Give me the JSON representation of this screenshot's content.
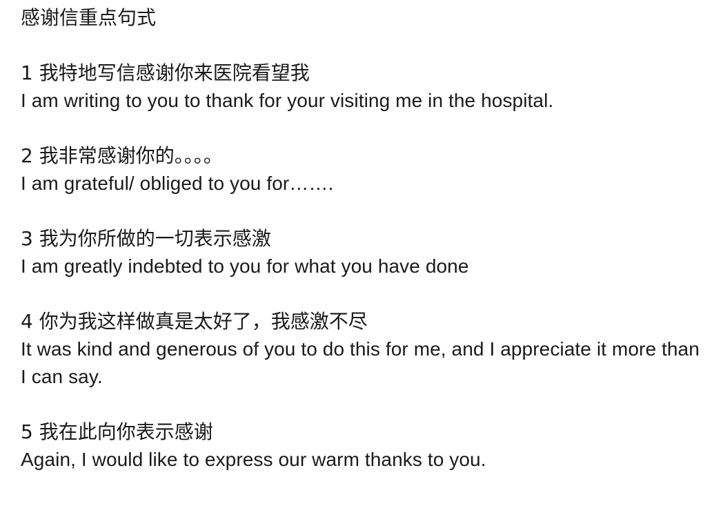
{
  "title": "感谢信重点句式",
  "items": [
    {
      "cn": "1 我特地写信感谢你来医院看望我",
      "en": "I am writing to you to thank for your visiting me in the hospital."
    },
    {
      "cn": "2 我非常感谢你的。。。。",
      "en": "I am grateful/ obliged to you for……."
    },
    {
      "cn": "3 我为你所做的一切表示感激",
      "en": "I am greatly indebted to you for what you have done"
    },
    {
      "cn": "4 你为我这样做真是太好了，我感激不尽",
      "en": "It was kind and generous of you to do this for me, and I appreciate it more than I can say."
    },
    {
      "cn": "5 我在此向你表示感谢",
      "en": "Again, I would like to express our warm thanks to you."
    }
  ]
}
